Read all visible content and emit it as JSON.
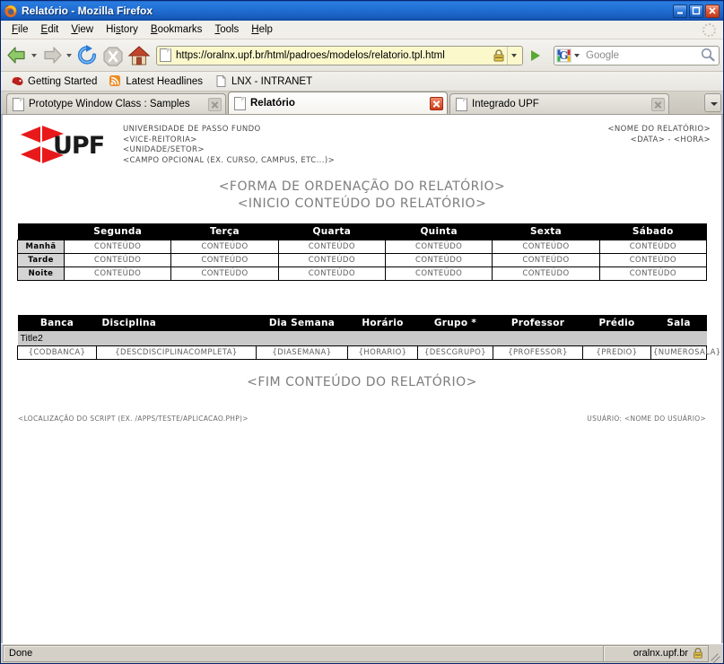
{
  "window": {
    "title": "Relatório - Mozilla Firefox",
    "app_icon": "firefox-icon",
    "minimize_label": "_",
    "maximize_label": "❐",
    "close_label": "✕"
  },
  "menu": {
    "items": [
      {
        "label": "File",
        "accel": "F"
      },
      {
        "label": "Edit",
        "accel": "E"
      },
      {
        "label": "View",
        "accel": "V"
      },
      {
        "label": "History",
        "accel": "s"
      },
      {
        "label": "Bookmarks",
        "accel": "B"
      },
      {
        "label": "Tools",
        "accel": "T"
      },
      {
        "label": "Help",
        "accel": "H"
      }
    ]
  },
  "toolbar": {
    "back_icon": "back-arrow-icon",
    "forward_icon": "forward-arrow-icon",
    "reload_icon": "reload-icon",
    "stop_icon": "stop-icon",
    "home_icon": "home-icon",
    "url": "https://oralnx.upf.br/html/padroes/modelos/relatorio.tpl.html",
    "url_lock_icon": "padlock-icon",
    "go_icon": "go-arrow-icon",
    "search_engine": "Google",
    "search_placeholder": "Google",
    "search_value": "",
    "search_icon": "magnifier-icon"
  },
  "bookmarks": [
    {
      "label": "Getting Started",
      "icon": "firefox-bookmark-icon"
    },
    {
      "label": "Latest Headlines",
      "icon": "rss-feed-icon"
    },
    {
      "label": "LNX - INTRANET",
      "icon": "page-icon"
    }
  ],
  "tabs": [
    {
      "label": "Prototype Window Class : Samples",
      "active": false
    },
    {
      "label": "Relatório",
      "active": true
    },
    {
      "label": "Integrado UPF",
      "active": false
    }
  ],
  "report": {
    "logo_text": "UPF",
    "logo_color": "#e8191b",
    "org_lines": [
      "UNIVERSIDADE DE PASSO FUNDO",
      "<VICE-REITORIA>",
      "<UNIDADE/SETOR>",
      "<CAMPO OPCIONAL (EX. CURSO, CAMPUS, ETC...)>"
    ],
    "meta_lines": [
      "<NOME DO RELATÓRIO>",
      "<DATA> - <HORA>"
    ],
    "center_lines": [
      "<FORMA DE ORDENAÇÃO DO RELATÓRIO>",
      "<INICIO CONTEÚDO DO RELATÓRIO>"
    ],
    "end_line": "<FIM CONTEÚDO DO RELATÓRIO>",
    "script_location": "<LOCALIZAÇÃO DO SCRIPT (EX. /APPS/TESTE/APLICACAO.PHP)>",
    "user_line": "USUÁRIO: <NOME DO USUÁRIO>"
  },
  "schedule_table": {
    "headers": [
      "",
      "Segunda",
      "Terça",
      "Quarta",
      "Quinta",
      "Sexta",
      "Sábado"
    ],
    "rows": [
      {
        "period": "Manhã",
        "cells": [
          "CONTEÚDO",
          "CONTEÚDO",
          "CONTEÚDO",
          "CONTEÚDO",
          "CONTEÚDO",
          "CONTEÚDO"
        ]
      },
      {
        "period": "Tarde",
        "cells": [
          "CONTEÚDO",
          "CONTEÚDO",
          "CONTEÚDO",
          "CONTEÚDO",
          "CONTEÚDO",
          "CONTEÚDO"
        ]
      },
      {
        "period": "Noite",
        "cells": [
          "CONTEÚDO",
          "CONTEÚDO",
          "CONTEÚDO",
          "CONTEÚDO",
          "CONTEÚDO",
          "CONTEÚDO"
        ]
      }
    ]
  },
  "detail_table": {
    "headers": [
      "Banca",
      "Disciplina",
      "Dia Semana",
      "Horário",
      "Grupo *",
      "Professor",
      "Prédio",
      "Sala"
    ],
    "group_title": "Title2",
    "rows": [
      [
        "{CODBANCA}",
        "{DESCDISCIPLINACOMPLETA}",
        "{DIASEMANA}",
        "{HORARIO}",
        "{DESCGRUPO}",
        "{PROFESSOR}",
        "{PREDIO}",
        "{NUMEROSALA}"
      ]
    ]
  },
  "statusbar": {
    "message": "Done",
    "domain": "oralnx.upf.br",
    "lock_icon": "padlock-icon"
  }
}
